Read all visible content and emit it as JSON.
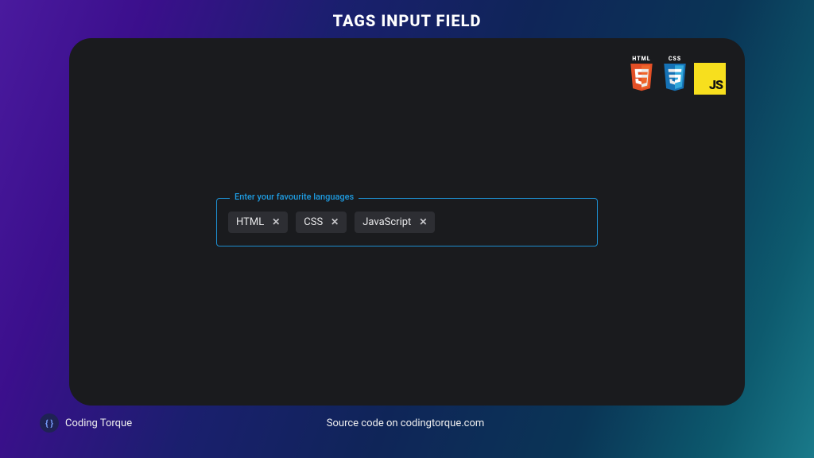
{
  "title": "TAGS INPUT FIELD",
  "badges": {
    "html_label": "HTML",
    "css_label": "CSS",
    "js_text": "JS"
  },
  "tags_field": {
    "legend": "Enter your favourite languages",
    "placeholder": "",
    "tags": [
      "HTML",
      "CSS",
      "JavaScript"
    ]
  },
  "footer": {
    "brand_name": "Coding Torque",
    "brand_glyph": "{ }",
    "source_text": "Source code on codingtorque.com"
  },
  "colors": {
    "accent": "#1e8ecf",
    "panel_bg": "#1a1b1e",
    "chip_bg": "#2d2e33",
    "js_yellow": "#f7df1e"
  }
}
